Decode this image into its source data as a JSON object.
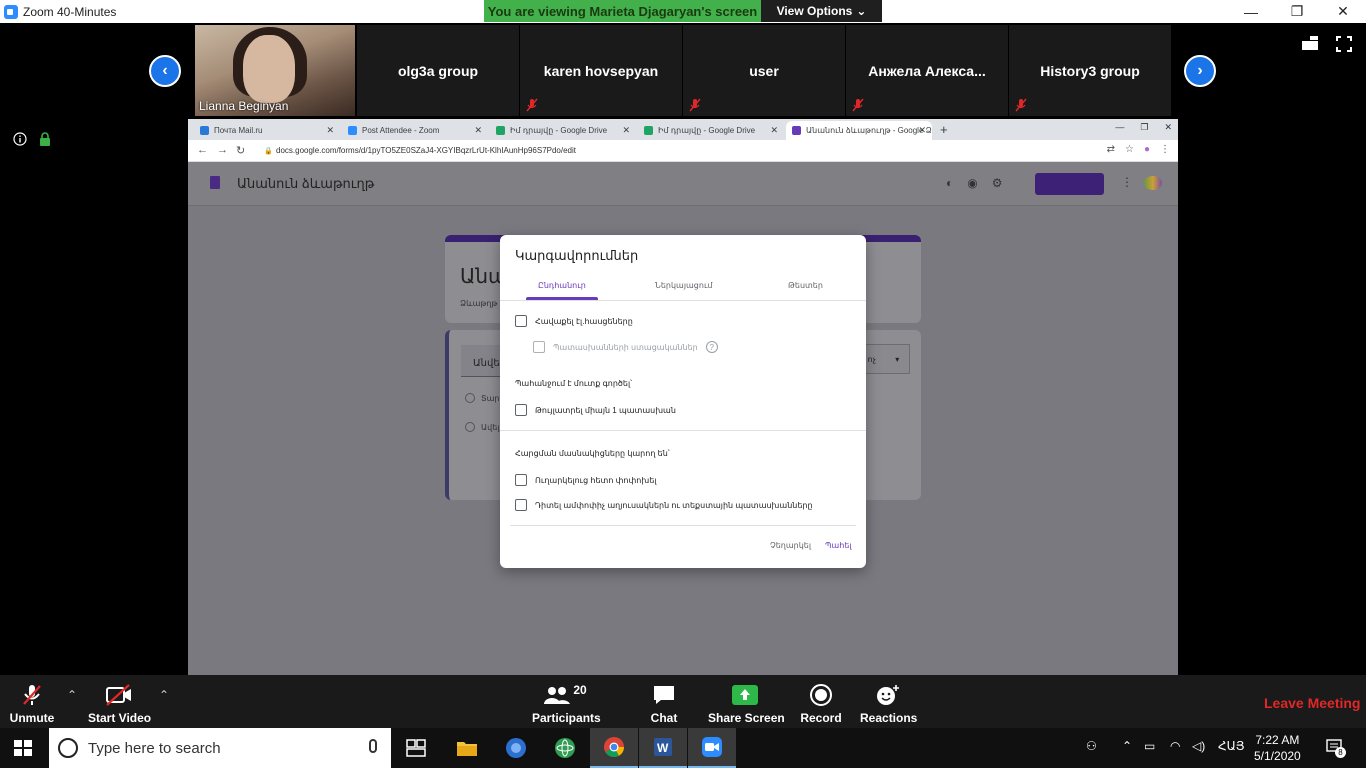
{
  "zoom": {
    "window_title": "Zoom 40-Minutes",
    "viewing_banner": "You are viewing Marieta Djagaryan's screen",
    "view_options": "View Options",
    "participants": [
      {
        "name": "Lianna Beginyan",
        "video": true
      },
      {
        "name": "olg3a group"
      },
      {
        "name": "karen hovsepyan"
      },
      {
        "name": "user"
      },
      {
        "name": "Анжела  Алекса..."
      },
      {
        "name": "History3 group"
      }
    ],
    "toolbar": {
      "unmute": "Unmute",
      "start_video": "Start Video",
      "participants": "Participants",
      "participants_count": "20",
      "chat": "Chat",
      "share_screen": "Share Screen",
      "record": "Record",
      "reactions": "Reactions",
      "leave": "Leave Meeting"
    }
  },
  "browser": {
    "tabs": [
      {
        "title": "Почта Mail.ru",
        "color": "#2b79d6"
      },
      {
        "title": "Post Attendee - Zoom",
        "color": "#2d8cff"
      },
      {
        "title": "Իմ դրայվը - Google Drive",
        "color": "#1fa463"
      },
      {
        "title": "Իմ դրայվը - Google Drive",
        "color": "#1fa463"
      },
      {
        "title": "Անանուն ձևաթուղթ - Google Ձ",
        "color": "#673ab7"
      }
    ],
    "url": "docs.google.com/forms/d/1pyTO5ZE0SZaJ4-XGYIBqzrLrUt-KlhIAunHp96S7Pdo/edit"
  },
  "forms": {
    "doc_title": "Անանուն ձևաթուղթ",
    "form_title_partial": "Անա",
    "form_desc_partial": "Ձևաթղթ",
    "question_partial": "Անվեր",
    "option1_partial": "Տարբ",
    "option2_partial": "Ավել",
    "qtype_partial": "ոչ"
  },
  "dialog": {
    "title": "Կարգավորումներ",
    "tabs": [
      "Ընդհանուր",
      "Ներկայացում",
      "Թեստեր"
    ],
    "collect_emails": "Հավաքել էլ.հասցեները",
    "response_receipts": "Պատասխանների ստացականներ",
    "requires_signin": "Պահանջում է մուտք գործել՝",
    "limit_one": "Թույլատրել միայն 1 պատասխան",
    "respondents_can": "Հարցման մասնակիցները կարող են՝",
    "edit_after": "Ուղարկելուց հետո փոփոխել",
    "see_summary": "Դիտել ամփոփիչ աղյուսակներն ու տեքստային պատասխանները",
    "cancel": "Չեղարկել",
    "save": "Պահել"
  },
  "taskbar": {
    "search_placeholder": "Type here to search",
    "lang": "ՀԱՅ",
    "time": "7:22 AM",
    "date": "5/1/2020",
    "notifications": "8"
  }
}
